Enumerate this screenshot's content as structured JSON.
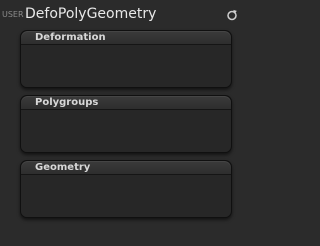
{
  "header": {
    "badge": "USER",
    "title": "DefoPolyGeometry"
  },
  "panels": [
    {
      "title": "Deformation"
    },
    {
      "title": "Polygroups"
    },
    {
      "title": "Geometry"
    }
  ]
}
